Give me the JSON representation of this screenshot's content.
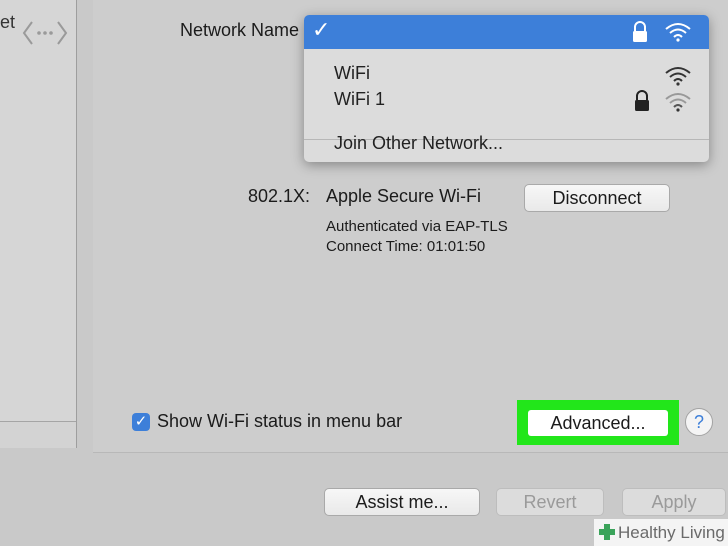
{
  "sidebar": {
    "partial_text": "et"
  },
  "network": {
    "label": "Network Name",
    "dropdown": {
      "checkmark": "✓",
      "items": [
        {
          "name": "WiFi",
          "locked": false
        },
        {
          "name": "WiFi 1",
          "locked": true
        }
      ],
      "join_other": "Join Other Network..."
    }
  },
  "security": {
    "label": "802.1X:",
    "value": "Apple Secure Wi-Fi",
    "disconnect_label": "Disconnect",
    "auth_line": "Authenticated via EAP-TLS",
    "connect_time": "Connect Time: 01:01:50"
  },
  "options": {
    "show_status_label": "Show Wi-Fi status in menu bar",
    "show_status_checked": true,
    "checkmark": "✓",
    "advanced_label": "Advanced...",
    "help_label": "?"
  },
  "footer": {
    "assist_label": "Assist me...",
    "revert_label": "Revert",
    "apply_label": "Apply"
  },
  "watermark": {
    "text": "Healthy Living"
  },
  "colors": {
    "highlight": "#22e61a",
    "selection": "#3d7fd9"
  }
}
